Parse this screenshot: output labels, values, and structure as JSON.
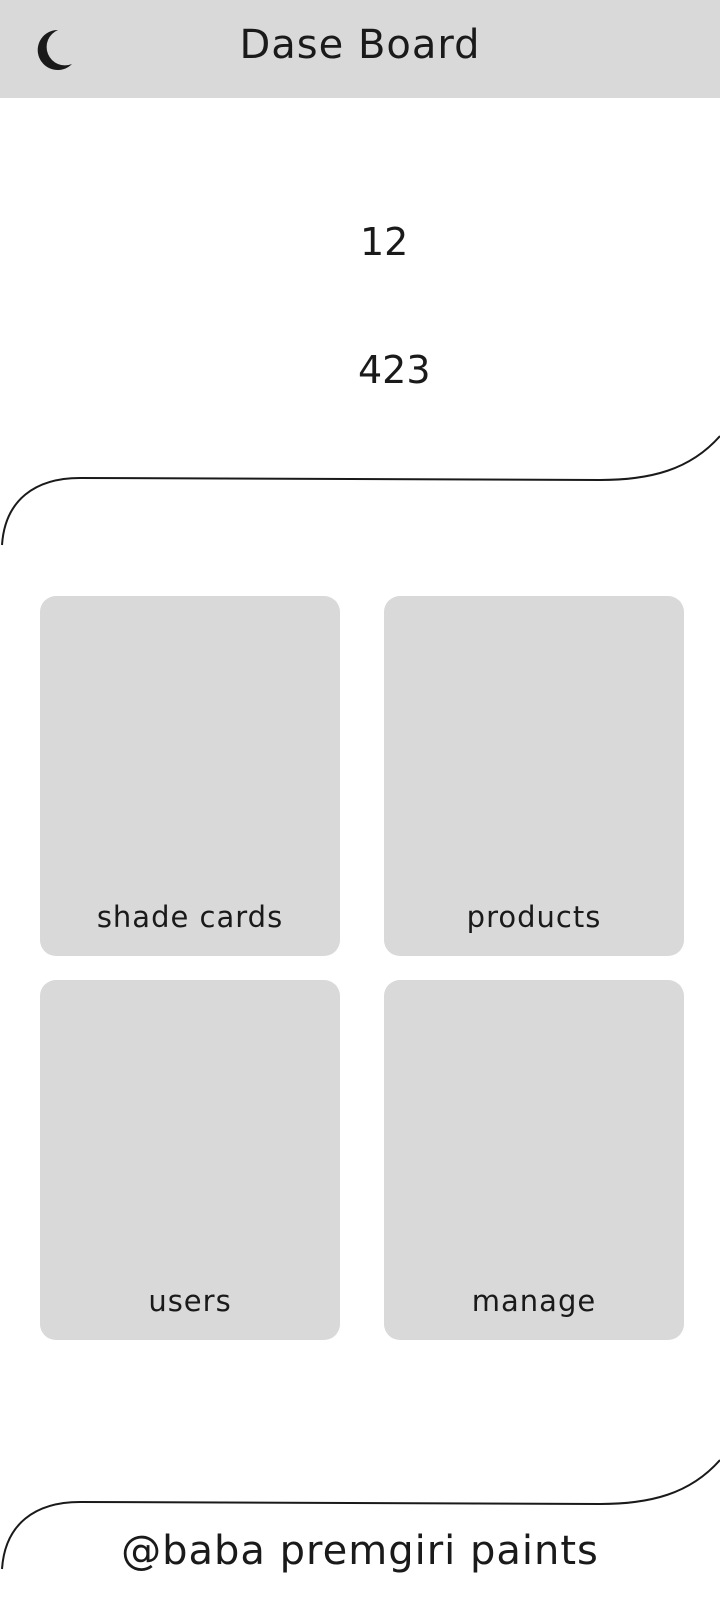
{
  "header": {
    "title": "Dase Board",
    "theme_toggle_icon": "moon-icon"
  },
  "stats": {
    "value_1": "12",
    "value_2": "423"
  },
  "tiles": [
    {
      "label": "shade cards"
    },
    {
      "label": "products"
    },
    {
      "label": "users"
    },
    {
      "label": "manage"
    }
  ],
  "footer": {
    "text": "@baba premgiri paints"
  },
  "colors": {
    "background": "#ffffff",
    "surface": "#d9d9d9",
    "text": "#1a1a1a"
  }
}
